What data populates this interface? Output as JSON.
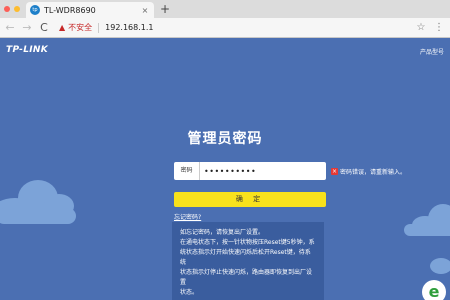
{
  "browser": {
    "tab_title": "TL-WDR8690",
    "favicon_text": "tp",
    "tab_close": "×",
    "new_tab": "+",
    "back": "←",
    "forward": "→",
    "reload": "C",
    "insecure_icon": "▲",
    "insecure_label": "不安全",
    "url": "192.168.1.1",
    "star": "☆",
    "menu": "⋮"
  },
  "header": {
    "logo": "TP-LINK",
    "product_model": "产品型号"
  },
  "login": {
    "title": "管理员密码",
    "password_label": "密码",
    "password_value": "••••••••••",
    "error_text": "密码错误，请重新输入。",
    "confirm_label": "确 定",
    "forgot_link": "忘记密码?",
    "help_lines": [
      "如忘记密码，请恢复出厂设置。",
      "在通电状态下，按一针状物按压Reset键5秒钟，系",
      "统状态指示灯开始快速闪烁后松开Reset键，待系统",
      "状态指示灯停止快速闪烁，路由器即恢复到出厂设置",
      "状态。"
    ]
  },
  "colors": {
    "page_bg": "#4b6fb2",
    "button": "#f8e21c",
    "error": "#e53935",
    "cloud": "#7ca3d8"
  }
}
